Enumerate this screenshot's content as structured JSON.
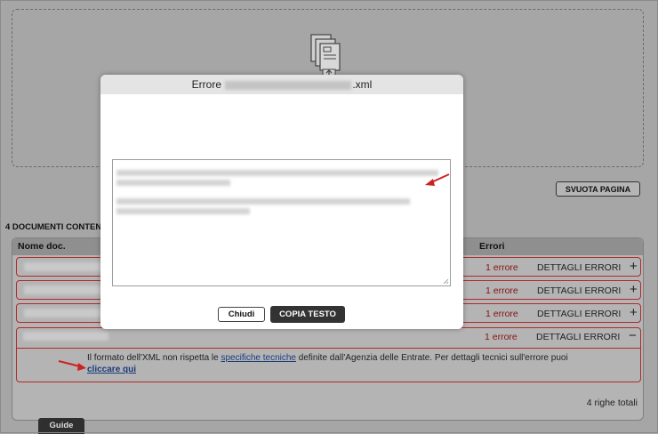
{
  "upload": {
    "icon": "document-upload-icon"
  },
  "toolbar": {
    "clear_label": "SVUOTA PAGINA"
  },
  "section": {
    "title": "4 DOCUMENTI CONTEN"
  },
  "table": {
    "headers": {
      "name": "Nome doc.",
      "errors": "Errori"
    },
    "rows": [
      {
        "errors": "1 errore",
        "details": "DETTAGLI ERRORI",
        "toggle": "+"
      },
      {
        "errors": "1 errore",
        "details": "DETTAGLI ERRORI",
        "toggle": "+"
      },
      {
        "errors": "1 errore",
        "details": "DETTAGLI ERRORI",
        "toggle": "+"
      },
      {
        "errors": "1 errore",
        "details": "DETTAGLI ERRORI",
        "toggle": "−"
      }
    ],
    "expanded_message": {
      "text_before": "Il formato dell'XML non rispetta le ",
      "link": "specifiche tecniche",
      "text_after": " definite dall'Agenzia delle Entrate. Per dettagli tecnici sull'errore puoi",
      "link2": "cliccare qui"
    },
    "total": "4 righe totali"
  },
  "guide_tab": "Guide",
  "modal": {
    "title_prefix": "Errore",
    "title_suffix": ".xml",
    "close_label": "Chiudi",
    "copy_label": "COPIA TESTO"
  },
  "colors": {
    "error_red": "#b02a2a",
    "arrow_red": "#cc2222",
    "dark_button": "#333333"
  }
}
